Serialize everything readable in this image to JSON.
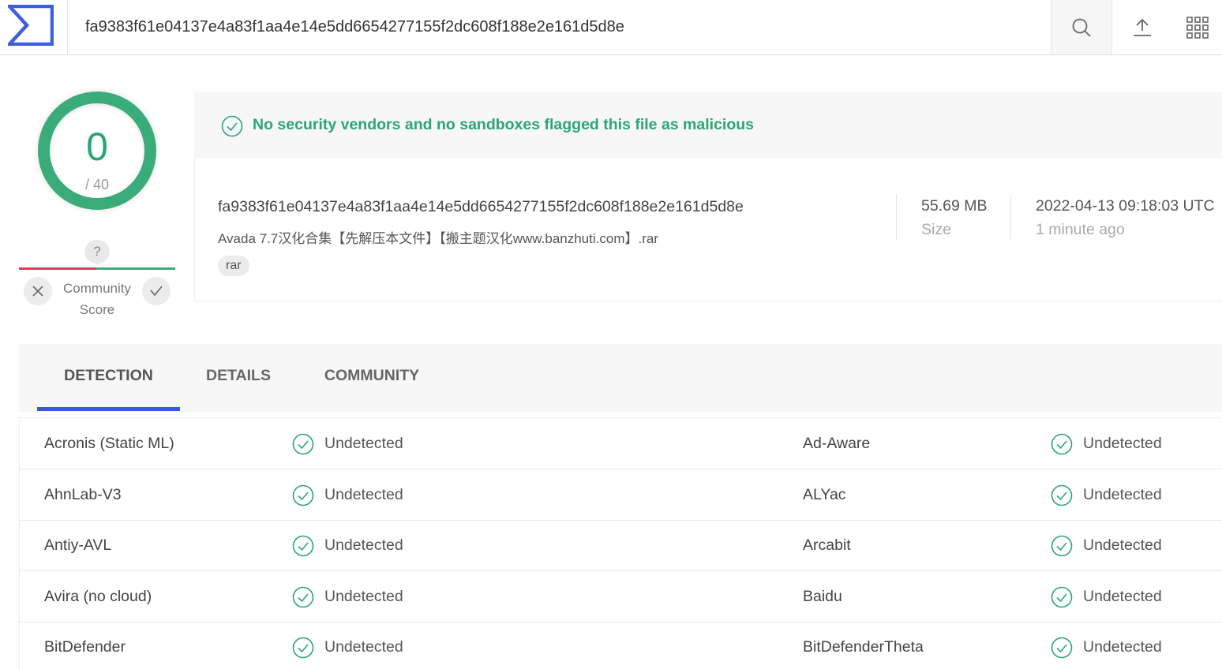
{
  "header": {
    "search_value": "fa9383f61e04137e4a83f1aa4e14e5dd6654277155f2dc608f188e2e161d5d8e"
  },
  "score": {
    "detections": "0",
    "total": "/ 40"
  },
  "community": {
    "unknown": "?",
    "label_line1": "Community",
    "label_line2": "Score"
  },
  "banner": {
    "message": "No security vendors and no sandboxes flagged this file as malicious",
    "color": "#2aa675"
  },
  "file": {
    "hash": "fa9383f61e04137e4a83f1aa4e14e5dd6654277155f2dc608f188e2e161d5d8e",
    "name": "Avada 7.7汉化合集【先解压本文件】【搬主题汉化www.banzhuti.com】.rar",
    "tag": "rar",
    "size_value": "55.69 MB",
    "size_label": "Size",
    "date_value": "2022-04-13 09:18:03 UTC",
    "date_label": "1 minute ago"
  },
  "tabs": [
    {
      "label": "DETECTION",
      "active": true
    },
    {
      "label": "DETAILS",
      "active": false
    },
    {
      "label": "COMMUNITY",
      "active": false
    }
  ],
  "detections": [
    {
      "left_engine": "Acronis (Static ML)",
      "left_result": "Undetected",
      "right_engine": "Ad-Aware",
      "right_result": "Undetected"
    },
    {
      "left_engine": "AhnLab-V3",
      "left_result": "Undetected",
      "right_engine": "ALYac",
      "right_result": "Undetected"
    },
    {
      "left_engine": "Antiy-AVL",
      "left_result": "Undetected",
      "right_engine": "Arcabit",
      "right_result": "Undetected"
    },
    {
      "left_engine": "Avira (no cloud)",
      "left_result": "Undetected",
      "right_engine": "Baidu",
      "right_result": "Undetected"
    },
    {
      "left_engine": "BitDefender",
      "left_result": "Undetected",
      "right_engine": "BitDefenderTheta",
      "right_result": "Undetected"
    }
  ],
  "colors": {
    "accent": "#3a5bd9",
    "clean": "#2aa675",
    "negative": "#e8345a"
  }
}
